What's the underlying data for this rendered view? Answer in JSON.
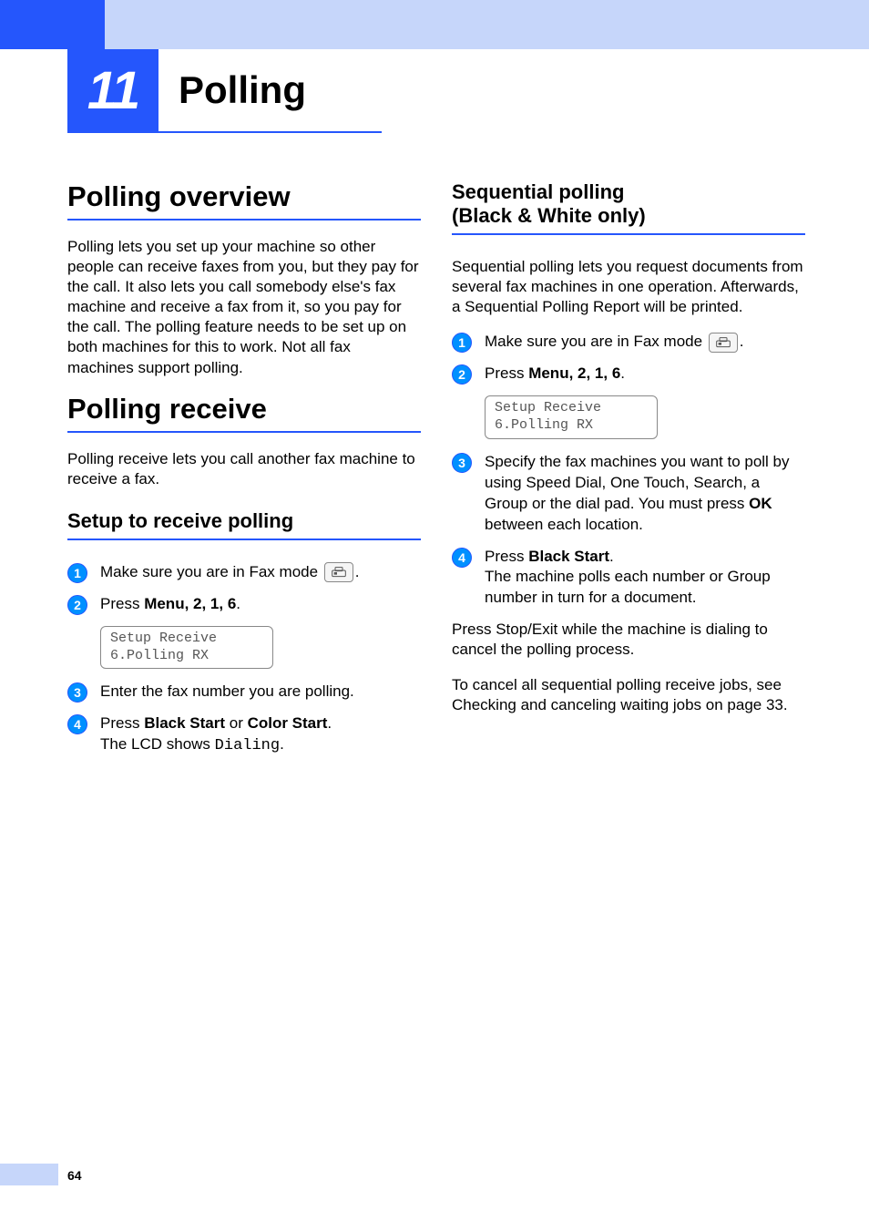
{
  "chapter": {
    "number": "11",
    "title": "Polling"
  },
  "page_number": "64",
  "left": {
    "h_overview": "Polling overview",
    "overview_body": "Polling lets you set up your machine so other people can receive faxes from you, but they pay for the call. It also lets you call somebody else's fax machine and receive a fax from it, so you pay for the call. The polling feature needs to be set up on both machines for this to work. Not all fax machines support polling.",
    "h_receive": "Polling receive",
    "receive_body": "Polling receive lets you call another fax machine to receive a fax.",
    "h_setup": "Setup to receive polling",
    "step1_a": "Make sure you are in Fax mode ",
    "step1_b": ".",
    "step2_a": "Press ",
    "step2_menu": "Menu",
    "step2_seq": ", 2, 1, 6",
    "step2_end": ".",
    "lcd1_line1": "Setup Receive",
    "lcd1_line2": "6.Polling RX",
    "step3": "Enter the fax number you are polling.",
    "step4_a": "Press ",
    "step4_blk": "Black Start",
    "step4_or": " or ",
    "step4_clr": "Color Start",
    "step4_end": ".",
    "step4_line2a": "The LCD shows ",
    "step4_dialing": "Dialing",
    "step4_line2end": "."
  },
  "right": {
    "h_seq": "Sequential polling (Black & White only)",
    "seq_body": "Sequential polling lets you request documents from several fax machines in one operation. Afterwards, a Sequential Polling Report will be printed.",
    "step1_a": "Make sure you are in Fax mode ",
    "step1_b": ".",
    "step2_a": "Press ",
    "step2_menu": "Menu",
    "step2_seq": ", 2, 1, 6",
    "step2_end": ".",
    "lcd1_line1": "Setup Receive",
    "lcd1_line2": "6.Polling RX",
    "step3_a": "Specify the fax machines you want to poll by using Speed Dial, One Touch, Search, a Group or the dial pad. You must press ",
    "step3_ok": "OK",
    "step3_b": " between each location.",
    "step4_a": "Press ",
    "step4_blk": "Black Start",
    "step4_end": ".",
    "step4_line2": "The machine polls each number or Group number in turn for a document.",
    "after1_a": "Press ",
    "after1_stop": "Stop/Exit",
    "after1_b": " while the machine is dialing to cancel the polling process.",
    "after2_a": "To cancel all sequential polling receive jobs, see ",
    "after2_ref": "Checking and canceling waiting jobs",
    "after2_b": " on page 33."
  }
}
